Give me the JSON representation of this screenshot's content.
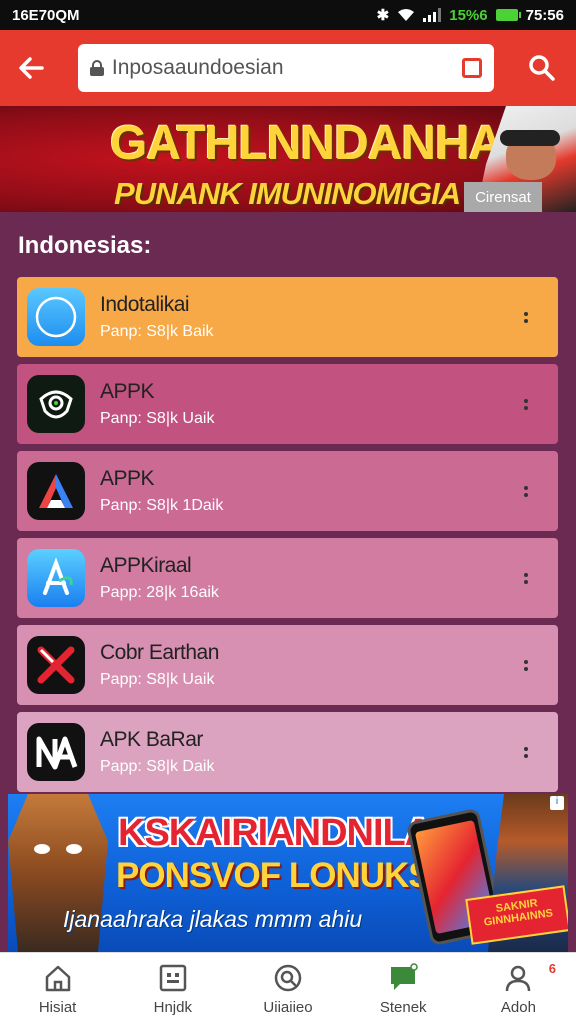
{
  "status_bar": {
    "left_text": "16E70QM",
    "battery_pct": "15%6",
    "time": "75:56"
  },
  "app_bar": {
    "url": "Inposaaundoesian"
  },
  "top_banner": {
    "title_line1": "GATHLNNDANHA",
    "title_line2": "PUNANK IMUNINOMIGIA",
    "button_label": "Cirensat"
  },
  "section": {
    "title": "Indonesias:"
  },
  "apps": [
    {
      "name": "Indotalikai",
      "meta": "Panp: S8|k Baik",
      "bg": "#f7a847",
      "icon": "compass-icon"
    },
    {
      "name": "APPK",
      "meta": "Panp: S8|k Uaik",
      "bg": "#c2527f",
      "icon": "eye-shield-icon"
    },
    {
      "name": "APPK",
      "meta": "Panp: S8|k 1Daik",
      "bg": "#cb6a93",
      "icon": "a-logo-icon"
    },
    {
      "name": "APPKiraal",
      "meta": "Papp: 28|k 16aik",
      "bg": "#d27ca2",
      "icon": "app-store-icon"
    },
    {
      "name": "Cobr Earthan",
      "meta": "Papp: S8|k Uaik",
      "bg": "#d890b2",
      "icon": "x-logo-icon"
    },
    {
      "name": "APK BaRar",
      "meta": "Papp: S8|k Daik",
      "bg": "#dca3c1",
      "icon": "na-logo-icon"
    }
  ],
  "bottom_banner": {
    "line1": "KSKAIRIANDNILA",
    "line2": "PONSVOF LONUKS",
    "line3": "Ijanaahraka jlakas mmm ahiu",
    "badge": "SAKNIR GINNHAINNS",
    "adchoice": "i"
  },
  "bottom_nav": [
    {
      "label": "Hisiat",
      "icon": "home-icon"
    },
    {
      "label": "Hnjdk",
      "icon": "grid-icon"
    },
    {
      "label": "Uiiaiieo",
      "icon": "search-circle-icon"
    },
    {
      "label": "Stenek",
      "icon": "chat-icon"
    },
    {
      "label": "Adoh",
      "icon": "profile-icon",
      "badge": "6"
    }
  ]
}
